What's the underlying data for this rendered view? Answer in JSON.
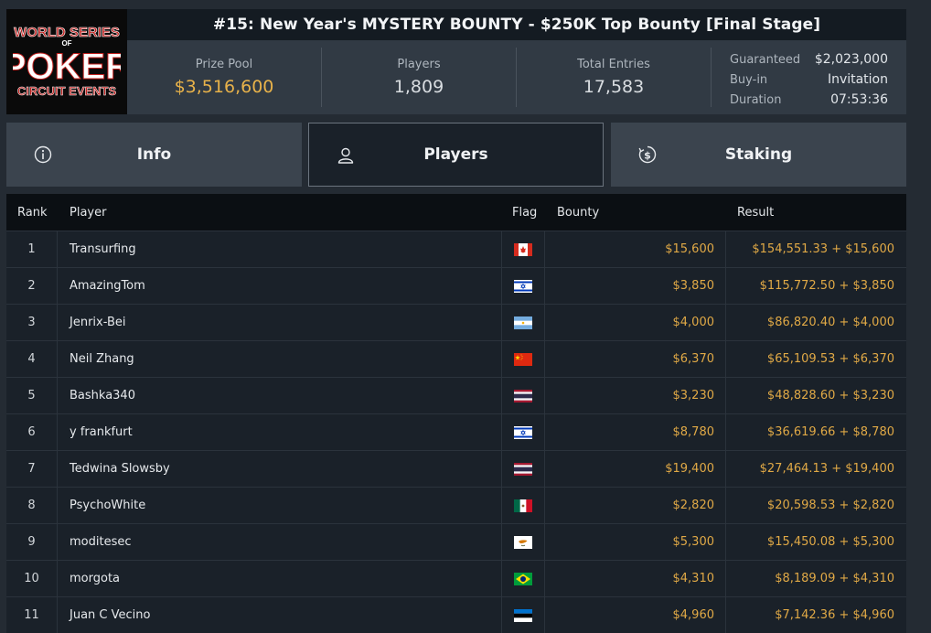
{
  "logo": {
    "line1": "WORLD SERIES",
    "line2": "OF",
    "line3": "POKER",
    "line4": "CIRCUIT EVENTS"
  },
  "title": "#15: New Year's MYSTERY BOUNTY - $250K Top Bounty [Final Stage]",
  "stats": {
    "prize_pool_label": "Prize Pool",
    "prize_pool": "$3,516,600",
    "players_label": "Players",
    "players": "1,809",
    "entries_label": "Total Entries",
    "entries": "17,583",
    "guaranteed_label": "Guaranteed",
    "guaranteed": "$2,023,000",
    "buyin_label": "Buy-in",
    "buyin": "Invitation",
    "duration_label": "Duration",
    "duration": "07:53:36"
  },
  "tabs": [
    {
      "label": "Info",
      "icon": "info-icon"
    },
    {
      "label": "Players",
      "icon": "user-icon"
    },
    {
      "label": "Staking",
      "icon": "dollar-refresh-icon"
    }
  ],
  "table": {
    "headers": {
      "rank": "Rank",
      "player": "Player",
      "flag": "Flag",
      "bounty": "Bounty",
      "result": "Result"
    },
    "rows": [
      {
        "rank": "1",
        "player": "Transurfing",
        "flag": "canada",
        "bounty": "$15,600",
        "result": "$154,551.33 + $15,600"
      },
      {
        "rank": "2",
        "player": "AmazingTom",
        "flag": "israel",
        "bounty": "$3,850",
        "result": "$115,772.50 + $3,850"
      },
      {
        "rank": "3",
        "player": "Jenrix-Bei",
        "flag": "argentina",
        "bounty": "$4,000",
        "result": "$86,820.40 + $4,000"
      },
      {
        "rank": "4",
        "player": "Neil Zhang",
        "flag": "china",
        "bounty": "$6,370",
        "result": "$65,109.53 + $6,370"
      },
      {
        "rank": "5",
        "player": "Bashka340",
        "flag": "thailand",
        "bounty": "$3,230",
        "result": "$48,828.60 + $3,230"
      },
      {
        "rank": "6",
        "player": "y frankfurt",
        "flag": "israel",
        "bounty": "$8,780",
        "result": "$36,619.66 + $8,780"
      },
      {
        "rank": "7",
        "player": "Tedwina Slowsby",
        "flag": "thailand",
        "bounty": "$19,400",
        "result": "$27,464.13 + $19,400"
      },
      {
        "rank": "8",
        "player": "PsychoWhite",
        "flag": "mexico",
        "bounty": "$2,820",
        "result": "$20,598.53 + $2,820"
      },
      {
        "rank": "9",
        "player": "moditesec",
        "flag": "cyprus",
        "bounty": "$5,300",
        "result": "$15,450.08 + $5,300"
      },
      {
        "rank": "10",
        "player": "morgota",
        "flag": "brazil",
        "bounty": "$4,310",
        "result": "$8,189.09 + $4,310"
      },
      {
        "rank": "11",
        "player": "Juan C Vecino",
        "flag": "estonia",
        "bounty": "$4,960",
        "result": "$7,142.36 + $4,960"
      }
    ]
  }
}
